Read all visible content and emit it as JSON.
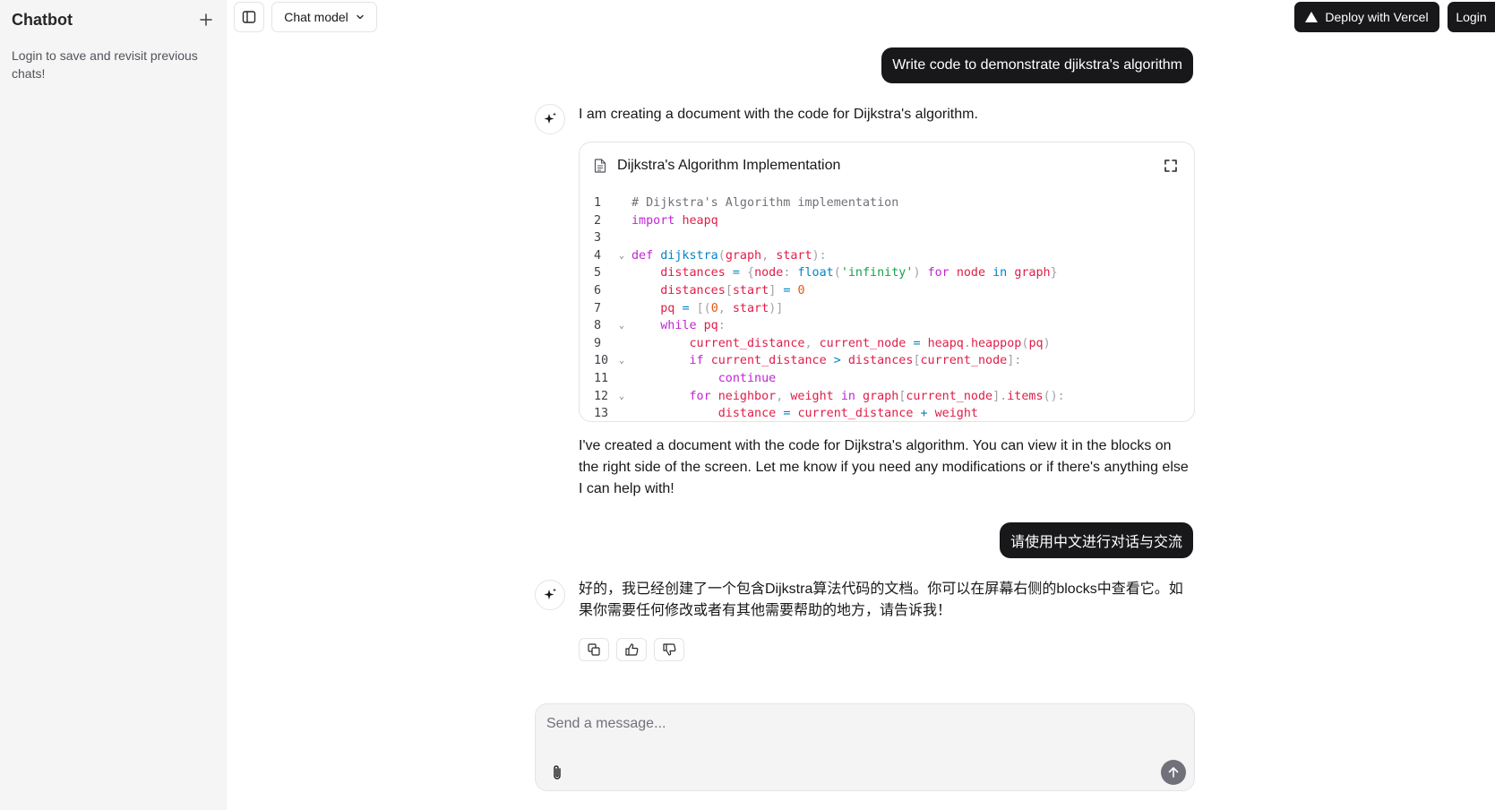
{
  "sidebar": {
    "brand": "Chatbot",
    "hint": "Login to save and revisit previous chats!"
  },
  "header": {
    "model_label": "Chat model",
    "deploy_label": "Deploy with Vercel",
    "login_label": "Login"
  },
  "messages": {
    "user_1": "Write code to demonstrate djikstra's algorithm",
    "ai_1": "I am creating a document with the code for Dijkstra's algorithm.",
    "document": {
      "title": "Dijkstra's Algorithm Implementation"
    },
    "ai_2": "I've created a document with the code for Dijkstra's algorithm. You can view it in the blocks on the right side of the screen. Let me know if you need any modifications or if there's anything else I can help with!",
    "user_2": "请使用中文进行对话与交流",
    "ai_3": "好的，我已经创建了一个包含Dijkstra算法代码的文档。你可以在屏幕右侧的blocks中查看它。如果你需要任何修改或者有其他需要帮助的地方，请告诉我！"
  },
  "code_lines": [
    {
      "n": "1",
      "fold": false,
      "tokens": [
        [
          "c-comment",
          "# Dijkstra's Algorithm implementation"
        ]
      ]
    },
    {
      "n": "2",
      "fold": false,
      "tokens": [
        [
          "c-kw",
          "import"
        ],
        [
          "",
          " "
        ],
        [
          "c-var",
          "heapq"
        ]
      ]
    },
    {
      "n": "3",
      "fold": false,
      "tokens": []
    },
    {
      "n": "4",
      "fold": true,
      "tokens": [
        [
          "c-kw",
          "def"
        ],
        [
          "",
          " "
        ],
        [
          "c-fn",
          "dijkstra"
        ],
        [
          "c-punc",
          "("
        ],
        [
          "c-var",
          "graph"
        ],
        [
          "c-punc",
          ", "
        ],
        [
          "c-var",
          "start"
        ],
        [
          "c-punc",
          "):"
        ]
      ]
    },
    {
      "n": "5",
      "fold": false,
      "tokens": [
        [
          "",
          "    "
        ],
        [
          "c-var",
          "distances"
        ],
        [
          "",
          " "
        ],
        [
          "c-op",
          "="
        ],
        [
          "",
          " "
        ],
        [
          "c-punc",
          "{"
        ],
        [
          "c-var",
          "node"
        ],
        [
          "c-punc",
          ": "
        ],
        [
          "c-fn",
          "float"
        ],
        [
          "c-punc",
          "("
        ],
        [
          "c-str",
          "'infinity'"
        ],
        [
          "c-punc",
          ")"
        ],
        [
          "",
          " "
        ],
        [
          "c-kw",
          "for"
        ],
        [
          "",
          " "
        ],
        [
          "c-var",
          "node"
        ],
        [
          "",
          " "
        ],
        [
          "c-op",
          "in"
        ],
        [
          "",
          " "
        ],
        [
          "c-var",
          "graph"
        ],
        [
          "c-punc",
          "}"
        ]
      ]
    },
    {
      "n": "6",
      "fold": false,
      "tokens": [
        [
          "",
          "    "
        ],
        [
          "c-var",
          "distances"
        ],
        [
          "c-punc",
          "["
        ],
        [
          "c-var",
          "start"
        ],
        [
          "c-punc",
          "]"
        ],
        [
          "",
          " "
        ],
        [
          "c-op",
          "="
        ],
        [
          "",
          " "
        ],
        [
          "c-num",
          "0"
        ]
      ]
    },
    {
      "n": "7",
      "fold": false,
      "tokens": [
        [
          "",
          "    "
        ],
        [
          "c-var",
          "pq"
        ],
        [
          "",
          " "
        ],
        [
          "c-op",
          "="
        ],
        [
          "",
          " "
        ],
        [
          "c-punc",
          "[("
        ],
        [
          "c-num",
          "0"
        ],
        [
          "c-punc",
          ", "
        ],
        [
          "c-var",
          "start"
        ],
        [
          "c-punc",
          ")]"
        ]
      ]
    },
    {
      "n": "8",
      "fold": true,
      "tokens": [
        [
          "",
          "    "
        ],
        [
          "c-kw",
          "while"
        ],
        [
          "",
          " "
        ],
        [
          "c-var",
          "pq"
        ],
        [
          "c-punc",
          ":"
        ]
      ]
    },
    {
      "n": "9",
      "fold": false,
      "tokens": [
        [
          "",
          "        "
        ],
        [
          "c-var",
          "current_distance"
        ],
        [
          "c-punc",
          ", "
        ],
        [
          "c-var",
          "current_node"
        ],
        [
          "",
          " "
        ],
        [
          "c-op",
          "="
        ],
        [
          "",
          " "
        ],
        [
          "c-var",
          "heapq"
        ],
        [
          "c-punc",
          "."
        ],
        [
          "c-var",
          "heappop"
        ],
        [
          "c-punc",
          "("
        ],
        [
          "c-var",
          "pq"
        ],
        [
          "c-punc",
          ")"
        ]
      ]
    },
    {
      "n": "10",
      "fold": true,
      "tokens": [
        [
          "",
          "        "
        ],
        [
          "c-kw",
          "if"
        ],
        [
          "",
          " "
        ],
        [
          "c-var",
          "current_distance"
        ],
        [
          "",
          " "
        ],
        [
          "c-op",
          ">"
        ],
        [
          "",
          " "
        ],
        [
          "c-var",
          "distances"
        ],
        [
          "c-punc",
          "["
        ],
        [
          "c-var",
          "current_node"
        ],
        [
          "c-punc",
          "]:"
        ]
      ]
    },
    {
      "n": "11",
      "fold": false,
      "tokens": [
        [
          "",
          "            "
        ],
        [
          "c-kw",
          "continue"
        ]
      ]
    },
    {
      "n": "12",
      "fold": true,
      "tokens": [
        [
          "",
          "        "
        ],
        [
          "c-kw",
          "for"
        ],
        [
          "",
          " "
        ],
        [
          "c-var",
          "neighbor"
        ],
        [
          "c-punc",
          ", "
        ],
        [
          "c-var",
          "weight"
        ],
        [
          "",
          " "
        ],
        [
          "c-kw",
          "in"
        ],
        [
          "",
          " "
        ],
        [
          "c-var",
          "graph"
        ],
        [
          "c-punc",
          "["
        ],
        [
          "c-var",
          "current_node"
        ],
        [
          "c-punc",
          "]."
        ],
        [
          "c-var",
          "items"
        ],
        [
          "c-punc",
          "():"
        ]
      ]
    },
    {
      "n": "13",
      "fold": false,
      "tokens": [
        [
          "",
          "            "
        ],
        [
          "c-var",
          "distance"
        ],
        [
          "",
          " "
        ],
        [
          "c-op",
          "="
        ],
        [
          "",
          " "
        ],
        [
          "c-var",
          "current_distance"
        ],
        [
          "",
          " "
        ],
        [
          "c-op",
          "+"
        ],
        [
          "",
          " "
        ],
        [
          "c-var",
          "weight"
        ]
      ]
    }
  ],
  "composer": {
    "placeholder": "Send a message..."
  }
}
